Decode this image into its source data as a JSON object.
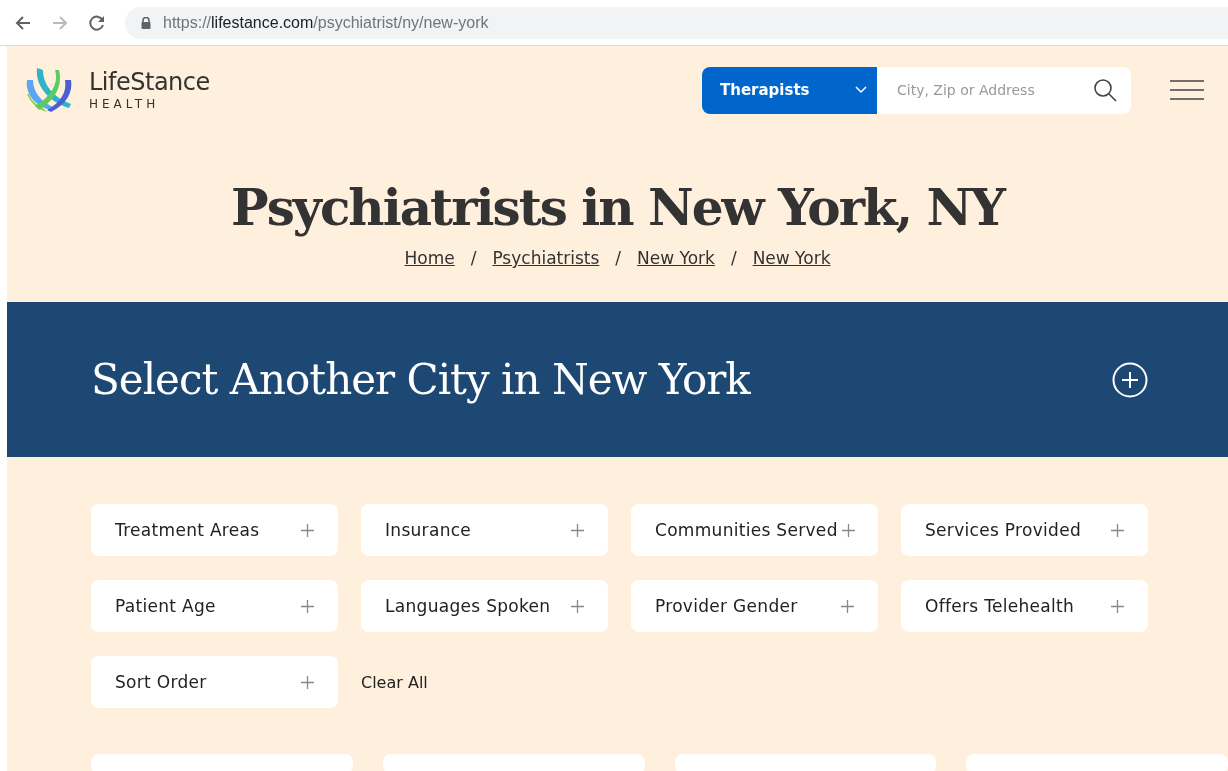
{
  "browser": {
    "url": {
      "scheme": "https://",
      "host": "lifestance.com",
      "path": "/psychiatrist/ny/new-york"
    },
    "forward_disabled": true
  },
  "header": {
    "logo": {
      "name": "LifeStance",
      "tagline": "HEALTH"
    },
    "search": {
      "category": "Therapists",
      "placeholder": "City, Zip or Address"
    }
  },
  "title": "Psychiatrists in New York, NY",
  "breadcrumb": {
    "separator": "/",
    "items": [
      "Home",
      "Psychiatrists",
      "New York",
      "New York"
    ]
  },
  "city_panel": {
    "title": "Select Another City in New York",
    "expanded": false
  },
  "filters": [
    {
      "label": "Treatment Areas"
    },
    {
      "label": "Insurance"
    },
    {
      "label": "Communities Served"
    },
    {
      "label": "Services Provided"
    },
    {
      "label": "Patient Age"
    },
    {
      "label": "Languages Spoken"
    },
    {
      "label": "Provider Gender"
    },
    {
      "label": "Offers Telehealth"
    },
    {
      "label": "Sort Order"
    }
  ],
  "clear_all": "Clear All"
}
